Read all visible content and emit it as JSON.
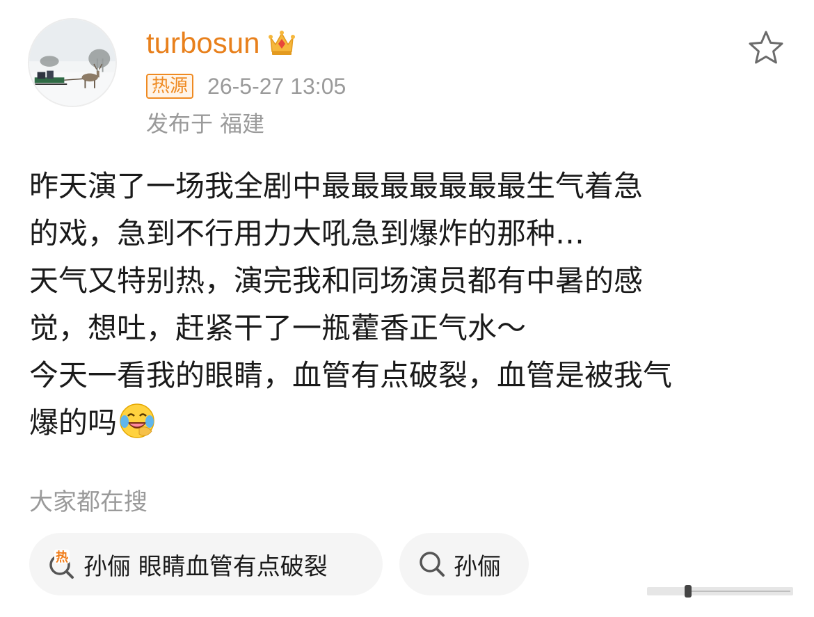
{
  "user": {
    "name": "turbosun",
    "badge": "热源",
    "timestamp": "26-5-27 13:05",
    "location": "发布于 福建"
  },
  "icons": {
    "avatar": "avatar-winter-sleigh",
    "verified": "crown-icon",
    "favorite": "star-icon",
    "emoji": "laugh-cry-emoji-icon",
    "hot_search": "hot-search-icon",
    "search": "search-icon"
  },
  "post": {
    "lines": [
      "昨天演了一场我全剧中最最最最最最最生气着急",
      "的戏，急到不行用力大吼急到爆炸的那种…",
      "天气又特别热，演完我和同场演员都有中暑的感",
      "觉，想吐，赶紧干了一瓶藿香正气水～",
      "今天一看我的眼睛，血管有点破裂，血管是被我气",
      "爆的吗"
    ]
  },
  "related": {
    "title": "大家都在搜",
    "chips": [
      {
        "label": "孙俪 眼睛血管有点破裂",
        "icon": "hot-search-icon"
      },
      {
        "label": "孙俪",
        "icon": "search-icon"
      }
    ]
  },
  "colors": {
    "username": "#e8801c",
    "badge": "#ef8a21",
    "muted": "#9a9a9a",
    "chip_bg": "#f5f5f5"
  }
}
